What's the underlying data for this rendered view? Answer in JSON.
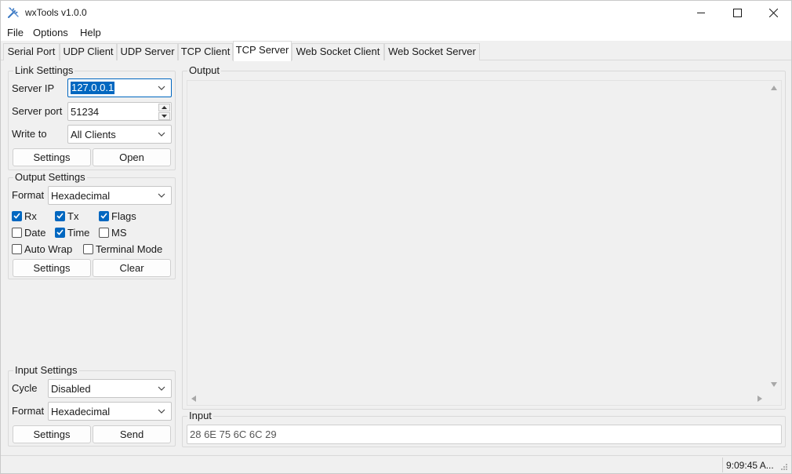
{
  "window": {
    "title": "wxTools v1.0.0"
  },
  "menu": [
    "File",
    "Options",
    "Help"
  ],
  "tabs": [
    "Serial Port",
    "UDP Client",
    "UDP Server",
    "TCP Client",
    "TCP Server",
    "Web Socket Client",
    "Web Socket Server"
  ],
  "active_tab": "TCP Server",
  "link_settings": {
    "title": "Link Settings",
    "server_ip_label": "Server IP",
    "server_ip_value": "127.0.0.1",
    "server_port_label": "Server port",
    "server_port_value": "51234",
    "write_to_label": "Write to",
    "write_to_value": "All Clients",
    "settings_label": "Settings",
    "open_label": "Open"
  },
  "output_settings": {
    "title": "Output Settings",
    "format_label": "Format",
    "format_value": "Hexadecimal",
    "rx": "Rx",
    "tx": "Tx",
    "flags": "Flags",
    "date": "Date",
    "time": "Time",
    "ms": "MS",
    "auto_wrap": "Auto Wrap",
    "terminal_mode": "Terminal Mode",
    "checked": {
      "rx": true,
      "tx": true,
      "flags": true,
      "date": false,
      "time": true,
      "ms": false,
      "auto_wrap": false,
      "terminal_mode": false
    },
    "settings_label": "Settings",
    "clear_label": "Clear"
  },
  "input_settings": {
    "title": "Input Settings",
    "cycle_label": "Cycle",
    "cycle_value": "Disabled",
    "format_label": "Format",
    "format_value": "Hexadecimal",
    "settings_label": "Settings",
    "send_label": "Send"
  },
  "output": {
    "title": "Output",
    "content": ""
  },
  "input": {
    "title": "Input",
    "value": "28 6E 75 6C 6C 29"
  },
  "status": {
    "time": "9:09:45 A..."
  },
  "colors": {
    "accent": "#0067c0",
    "window_bg": "#f0f0f0",
    "title_bg": "#ffffff"
  },
  "icons": {
    "app": "wrench-screwdriver-icon"
  }
}
